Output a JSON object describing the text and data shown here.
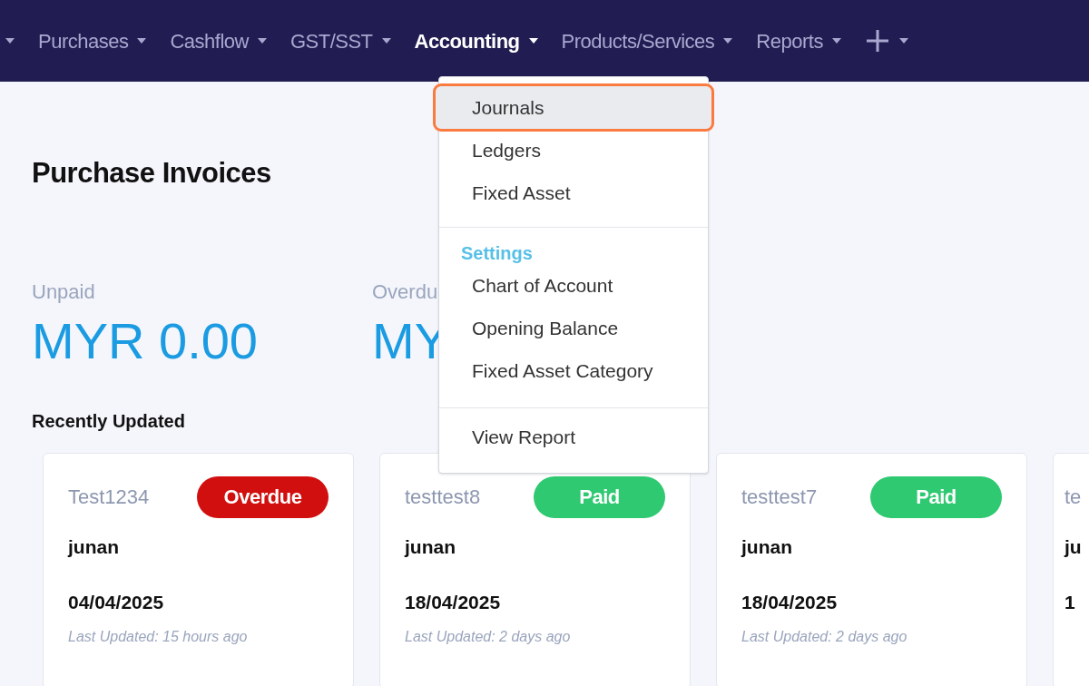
{
  "nav": {
    "items": [
      {
        "label": "Purchases",
        "selected": false
      },
      {
        "label": "Cashflow",
        "selected": false
      },
      {
        "label": "GST/SST",
        "selected": false
      },
      {
        "label": "Accounting",
        "selected": true
      },
      {
        "label": "Products/Services",
        "selected": false
      },
      {
        "label": "Reports",
        "selected": false
      }
    ]
  },
  "menu": {
    "groups": [
      {
        "items": [
          {
            "label": "Journals",
            "selected": true
          },
          {
            "label": "Ledgers",
            "selected": false
          },
          {
            "label": "Fixed Asset",
            "selected": false
          }
        ]
      },
      {
        "heading": "Settings",
        "items": [
          {
            "label": "Chart of Account",
            "selected": false
          },
          {
            "label": "Opening Balance",
            "selected": false
          },
          {
            "label": "Fixed Asset Category",
            "selected": false
          }
        ]
      },
      {
        "items": [
          {
            "label": "View Report",
            "selected": false
          }
        ]
      }
    ]
  },
  "page": {
    "title": "Purchase Invoices",
    "summary": [
      {
        "label": "Unpaid",
        "amount": "MYR 0.00"
      },
      {
        "label": "Overdu",
        "amount": "MY"
      }
    ],
    "recent_heading": "Recently Updated",
    "cards": [
      {
        "ref": "Test1234",
        "status": "Overdue",
        "color": "#d10f0f",
        "name": "junan",
        "date": "04/04/2025",
        "updated": "Last Updated: 15 hours ago"
      },
      {
        "ref": "testtest8",
        "status": "Paid",
        "color": "#2ec971",
        "name": "junan",
        "date": "18/04/2025",
        "updated": "Last Updated: 2 days ago"
      },
      {
        "ref": "testtest7",
        "status": "Paid",
        "color": "#2ec971",
        "name": "junan",
        "date": "18/04/2025",
        "updated": "Last Updated: 2 days ago"
      }
    ],
    "partial_card": {
      "ref": "te",
      "name": "ju",
      "date": "1"
    }
  }
}
